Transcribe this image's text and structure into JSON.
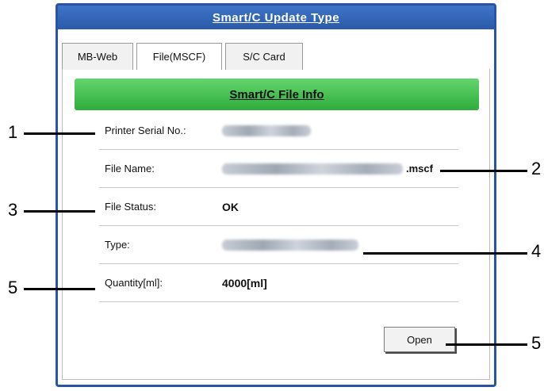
{
  "window": {
    "title": "Smart/C Update Type"
  },
  "tabs": [
    {
      "label": "MB-Web",
      "active": false
    },
    {
      "label": "File(MSCF)",
      "active": true
    },
    {
      "label": "S/C Card",
      "active": false
    }
  ],
  "info_bar": {
    "title": "Smart/C File Info"
  },
  "fields": {
    "serial": {
      "label": "Printer Serial No.:"
    },
    "filename": {
      "label": "File Name:",
      "extension": ".mscf"
    },
    "status": {
      "label": "File Status:",
      "value": "OK"
    },
    "type": {
      "label": "Type:"
    },
    "quantity": {
      "label": "Quantity[ml]:",
      "value": "4000[ml]"
    }
  },
  "buttons": {
    "open": "Open"
  },
  "callouts": {
    "c1": "1",
    "c2": "2",
    "c3": "3",
    "c4": "4",
    "c5a": "5",
    "c5b": "5"
  },
  "colors": {
    "title_bar": "#2a5aa9",
    "info_bar": "#3fbf4a"
  }
}
